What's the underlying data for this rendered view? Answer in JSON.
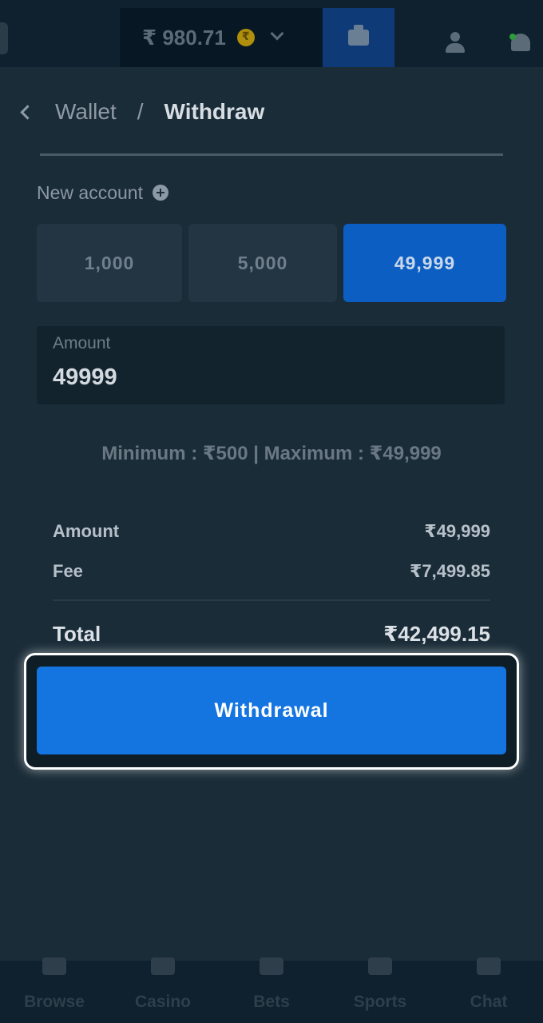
{
  "header": {
    "balance": "₹ 980.71",
    "currency_icon": "rupee-coin-icon",
    "wallet_icon": "wallet-icon",
    "user_icon": "user-icon",
    "notification_icon": "bell-icon"
  },
  "breadcrumb": {
    "parent": "Wallet",
    "separator": "/",
    "current": "Withdraw"
  },
  "new_account": {
    "label": "New account"
  },
  "presets": [
    "1,000",
    "5,000",
    "49,999"
  ],
  "selected_preset": "49,999",
  "amount_field": {
    "label": "Amount",
    "value": "49999"
  },
  "limits_text": "Minimum : ₹500 | Maximum : ₹49,999",
  "summary": {
    "amount_label": "Amount",
    "amount_value": "₹49,999",
    "fee_label": "Fee",
    "fee_value": "₹7,499.85",
    "total_label": "Total",
    "total_value": "₹42,499.15"
  },
  "withdraw_button": {
    "label": "Withdrawal"
  },
  "bottom_nav": [
    {
      "label": "Browse",
      "icon": "browse-icon"
    },
    {
      "label": "Casino",
      "icon": "casino-icon"
    },
    {
      "label": "Bets",
      "icon": "bets-icon"
    },
    {
      "label": "Sports",
      "icon": "sports-icon"
    },
    {
      "label": "Chat",
      "icon": "chat-icon"
    }
  ],
  "colors": {
    "background": "#1a2c38",
    "accent": "#1475e1",
    "selected_preset": "#0c5ec2"
  }
}
